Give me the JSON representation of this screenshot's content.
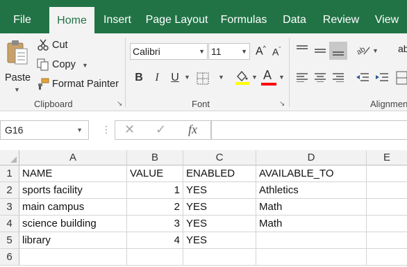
{
  "tabs": [
    "File",
    "Home",
    "Insert",
    "Page Layout",
    "Formulas",
    "Data",
    "Review",
    "View"
  ],
  "active_tab": "Home",
  "clipboard": {
    "paste_label": "Paste",
    "cut_label": "Cut",
    "copy_label": "Copy",
    "format_painter_label": "Format Painter",
    "group_label": "Clipboard"
  },
  "font": {
    "font_name": "Calibri",
    "font_size": "11",
    "bold_label": "B",
    "italic_label": "I",
    "underline_label": "U",
    "increase_size_label": "A",
    "decrease_size_label": "A",
    "font_color_label": "A",
    "group_label": "Font"
  },
  "alignment": {
    "group_label": "Alignment",
    "wrap_label": "ab"
  },
  "formula_bar": {
    "name_box": "G16",
    "fx_label": "fx",
    "formula": ""
  },
  "colors": {
    "brand": "#217346",
    "fill_highlight": "#ffff00",
    "font_color": "#ff0000"
  },
  "columns": [
    "A",
    "B",
    "C",
    "D",
    "E"
  ],
  "rows": [
    "1",
    "2",
    "3",
    "4",
    "5",
    "6"
  ],
  "cells": [
    [
      "NAME",
      "VALUE",
      "ENABLED",
      "AVAILABLE_TO",
      ""
    ],
    [
      "sports facility",
      "1",
      "YES",
      "Athletics",
      ""
    ],
    [
      "main campus",
      "2",
      "YES",
      "Math",
      ""
    ],
    [
      "science building",
      "3",
      "YES",
      "Math",
      ""
    ],
    [
      "library",
      "4",
      "YES",
      "",
      ""
    ],
    [
      "",
      "",
      "",
      "",
      ""
    ]
  ]
}
